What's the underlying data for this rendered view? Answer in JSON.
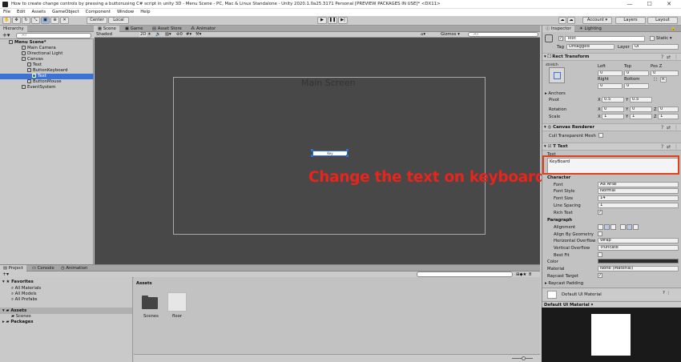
{
  "window": {
    "title": "How to create change controls by pressing a buttonusing C# script in unity 3D - Menu Scene - PC, Mac & Linux Standalone - Unity 2020.1.0a25.3171 Personal [PREVIEW PACKAGES IN USE]* <DX11>",
    "controls": "— ☐ ✕"
  },
  "menu": [
    "File",
    "Edit",
    "Assets",
    "GameObject",
    "Component",
    "Window",
    "Help"
  ],
  "toolbar": {
    "center": "Center",
    "local": "Local",
    "account": "Account ▾",
    "layers": "Layers",
    "layout": "Layout"
  },
  "hierarchy": {
    "tab": "Hierarchy",
    "search": "All",
    "scene": "Menu Scene*",
    "items": [
      "Main Camera",
      "Directional Light",
      "Canvas",
      "Text",
      "ButtonKeyboard",
      "Text",
      "ButtonMouse",
      "EventSystem"
    ]
  },
  "scene": {
    "tabs": [
      "Scene",
      "Game",
      "Asset Store",
      "Animator"
    ],
    "shading": "Shaded",
    "mode2d": "2D",
    "gizmos": "Gizmos ▾",
    "search": "All",
    "canvas_label": "Main Screen",
    "button_label": "Key",
    "annotation": "Change the text on keyboard"
  },
  "inspector": {
    "tabs": [
      "Inspector",
      "Lighting"
    ],
    "object_name": "Text",
    "static": "Static ▾",
    "tag_label": "Tag",
    "tag": "Untagged",
    "layer_label": "Layer",
    "layer": "UI",
    "rect": {
      "title": "Rect Transform",
      "anchor_side": "stretch",
      "left_label": "Left",
      "top_label": "Top",
      "posz_label": "Pos Z",
      "left": "0",
      "top": "0",
      "posz": "0",
      "right_label": "Right",
      "bottom_label": "Bottom",
      "right": "0",
      "bottom": "0",
      "blueprint": "R",
      "anchors": "Anchors",
      "pivot": "Pivot",
      "pivot_x": "0.5",
      "pivot_y": "0.5",
      "rotation": "Rotation",
      "rot_x": "0",
      "rot_y": "0",
      "rot_z": "0",
      "scale": "Scale",
      "scale_x": "1",
      "scale_y": "1",
      "scale_z": "1"
    },
    "renderer": {
      "title": "Canvas Renderer",
      "cull": "Cull Transparent Mesh"
    },
    "text": {
      "title": "Text",
      "text_label": "Text",
      "value": "KeyBoard",
      "character": "Character",
      "font_label": "Font",
      "font": "Arial",
      "style_label": "Font Style",
      "style": "Normal",
      "size_label": "Font Size",
      "size": "14",
      "spacing_label": "Line Spacing",
      "spacing": "1",
      "rich_label": "Rich Text",
      "paragraph": "Paragraph",
      "align_label": "Alignment",
      "geometry_label": "Align By Geometry",
      "hover_label": "Horizontal Overflow",
      "hover": "Wrap",
      "vover_label": "Vertical Overflow",
      "vover": "Truncate",
      "bestfit_label": "Best Fit",
      "color_label": "Color",
      "material_label": "Material",
      "material": "None (Material)",
      "raycast_label": "Raycast Target",
      "padding_label": "Raycast Padding"
    },
    "material_preview": "Default UI Material",
    "preview_title": "Default UI Material ▾"
  },
  "project": {
    "tabs": [
      "Project",
      "Console",
      "Animation"
    ],
    "favorites": "Favorites",
    "fav_items": [
      "All Materials",
      "All Models",
      "All Prefabs"
    ],
    "assets": "Assets",
    "asset_items": [
      "Scenes"
    ],
    "packages": "Packages",
    "assets_header": "Assets",
    "files": [
      "Scenes",
      "floor"
    ],
    "count": "8"
  },
  "colors": {
    "annotation": "#e8241c",
    "highlight_box": "#e0401b",
    "selection": "#3a72d8"
  }
}
